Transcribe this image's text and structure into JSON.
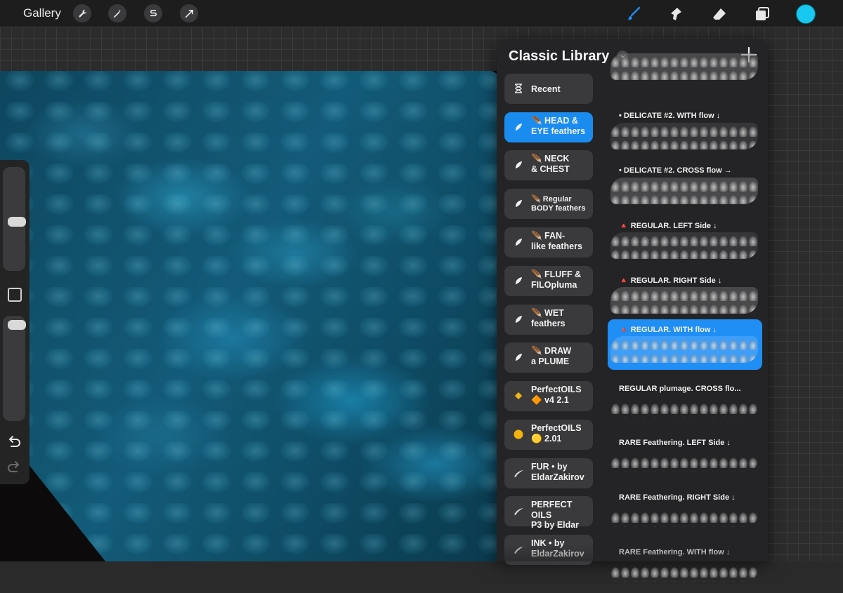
{
  "topbar": {
    "gallery_label": "Gallery",
    "left_tools": [
      "wrench-icon",
      "magic-wand-icon",
      "selection-icon",
      "transform-icon"
    ],
    "right_tools": [
      "brush-icon",
      "smudge-icon",
      "eraser-icon",
      "layers-icon"
    ],
    "active_tool": "brush-icon",
    "active_color": "#18c8f0"
  },
  "sidebar": {
    "size_slider_level": 0.55,
    "opacity_slider_level": 0.05,
    "modify_button_icon": "square-icon",
    "undo_icon": "undo-icon",
    "redo_icon": "redo-icon"
  },
  "brush_library": {
    "title": "Classic Library",
    "add_icon": "plus-icon",
    "sets": [
      {
        "icon": "hourglass-icon",
        "label": "Recent",
        "active": false
      },
      {
        "icon": "feather-icon",
        "label": "🪶 HEAD &\nEYE feathers",
        "active": true
      },
      {
        "icon": "feather-icon",
        "label": "🪶 NECK\n& CHEST",
        "active": false
      },
      {
        "icon": "feather-icon",
        "label": "🪶 Regular\nBODY feathers",
        "active": false
      },
      {
        "icon": "feather-icon",
        "label": "🪶 FAN-\nlike feathers",
        "active": false
      },
      {
        "icon": "feather-icon",
        "label": "🪶 FLUFF &\nFILOpluma",
        "active": false
      },
      {
        "icon": "feather-icon",
        "label": "🪶 WET\nfeathers",
        "active": false
      },
      {
        "icon": "feather-icon",
        "label": "🪶 DRAW\na PLUME",
        "active": false
      },
      {
        "icon": "diamond-icon",
        "label": "PerfectOILS\n🔶 v4 2.1",
        "active": false
      },
      {
        "icon": "circle-icon",
        "label": "PerfectOILS\n🟡 2.01",
        "active": false
      },
      {
        "icon": "stroke-icon",
        "label": "FUR • by\nEldarZakirov",
        "active": false
      },
      {
        "icon": "stroke-icon",
        "label": "PERFECT OILS\nP3 by Eldar",
        "active": false
      },
      {
        "icon": "stroke-icon",
        "label": "INK • by\nEldarZakirov",
        "active": false
      }
    ],
    "brushes": [
      {
        "name": "",
        "active": false
      },
      {
        "name": "• DELICATE #2. WITH flow ↓",
        "active": false
      },
      {
        "name": "• DELICATE #2. CROSS flow →",
        "active": false
      },
      {
        "name": "🔺 REGULAR. LEFT Side ↓",
        "active": false
      },
      {
        "name": "🔺 REGULAR. RIGHT Side ↓",
        "active": false
      },
      {
        "name": "🔺 REGULAR. WITH flow ↓",
        "active": true
      },
      {
        "name": "REGULAR plumage. CROSS flo...",
        "active": false
      },
      {
        "name": "RARE Feathering. LEFT Side ↓",
        "active": false
      },
      {
        "name": "RARE Feathering. RIGHT Side ↓",
        "active": false
      },
      {
        "name": "RARE Feathering. WITH flow ↓",
        "active": false
      }
    ]
  }
}
